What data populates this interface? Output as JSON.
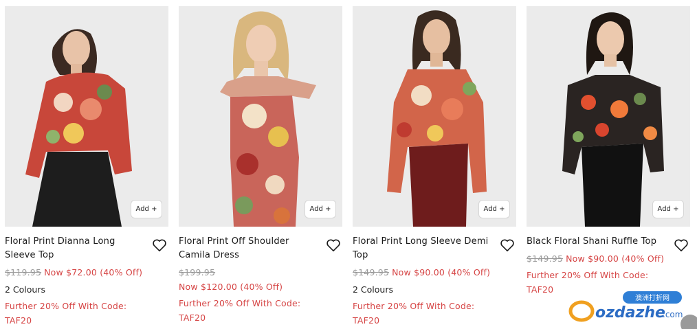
{
  "products": [
    {
      "title": "Floral Print Dianna Long Sleeve Top",
      "old_price": "$119.95",
      "now_price": "Now $72.00 (40% Off)",
      "colours": "2 Colours",
      "promo_line1": "Further 20% Off With Code:",
      "promo_line2": "TAF20",
      "add_label": "Add +",
      "top_color": "#c8473a",
      "bottom_color": "#1d1d1d"
    },
    {
      "title": "Floral Print Off Shoulder Camila Dress",
      "old_price": "$199.95",
      "now_price": "Now $120.00 (40% Off)",
      "promo_line1": "Further 20% Off With Code:",
      "promo_line2": "TAF20",
      "add_label": "Add +",
      "top_color": "#d9a08a",
      "bottom_color": "#c9655a"
    },
    {
      "title": "Floral Print Long Sleeve Demi Top",
      "old_price": "$149.95",
      "now_price": "Now $90.00 (40% Off)",
      "colours": "2 Colours",
      "promo_line1": "Further 20% Off With Code:",
      "promo_line2": "TAF20",
      "add_label": "Add +",
      "top_color": "#d2654a",
      "bottom_color": "#6e1c1c"
    },
    {
      "title": "Black Floral Shani Ruffle Top",
      "old_price": "$149.95",
      "now_price": "Now $90.00 (40% Off)",
      "promo_line1": "Further 20% Off With Code:",
      "promo_line2": "TAF20",
      "add_label": "Add +",
      "top_color": "#2a2422",
      "bottom_color": "#111111"
    }
  ],
  "watermark": {
    "brand": "ozdazhe",
    "tld": ".com",
    "badge": "澳洲打折网"
  },
  "colors": {
    "sale": "#d64545",
    "strike": "#9a9a9a",
    "photo_bg": "#ebebeb"
  }
}
